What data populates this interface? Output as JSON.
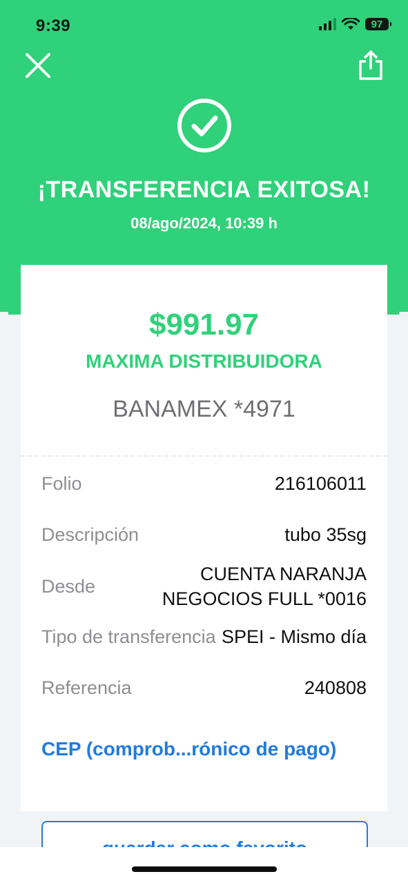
{
  "status_bar": {
    "time": "9:39",
    "battery": "97"
  },
  "header": {
    "title": "¡TRANSFERENCIA EXITOSA!",
    "date": "08/ago/2024, 10:39 h"
  },
  "receipt": {
    "amount": "$991.97",
    "recipient": "MAXIMA DISTRIBUIDORA",
    "account": "BANAMEX *4971",
    "details": [
      {
        "label": "Folio",
        "value": "216106011"
      },
      {
        "label": "Descripción",
        "value": "tubo 35sg"
      },
      {
        "label": "Desde",
        "value_line1": "CUENTA NARANJA",
        "value_line2": "NEGOCIOS FULL *0016"
      },
      {
        "label": "Tipo de transferencia",
        "value": "SPEI - Mismo día"
      },
      {
        "label": "Referencia",
        "value": "240808"
      }
    ],
    "cep_link": "CEP (comprob...rónico de pago)"
  },
  "actions": {
    "favorite_label": "guardar como favorito"
  },
  "colors": {
    "brand_green": "#2fd17a",
    "link_blue": "#1f7be0",
    "background": "#f1f4f6"
  }
}
